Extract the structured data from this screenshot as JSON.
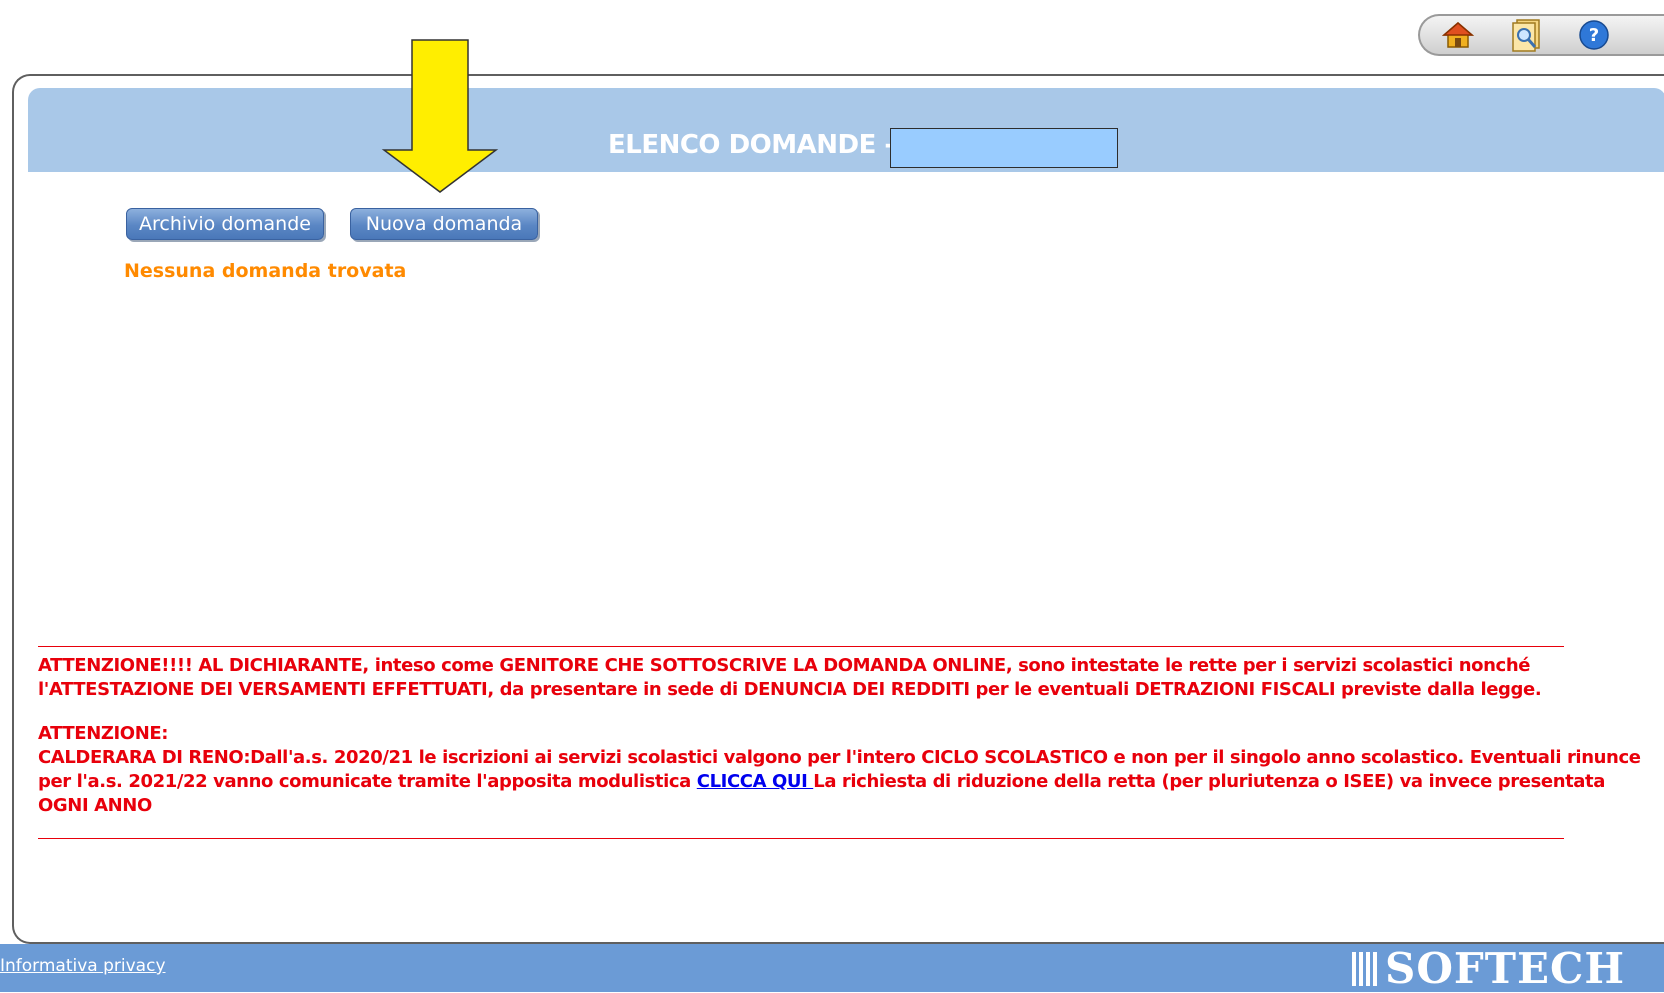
{
  "toolbar": {
    "icons": [
      "home-icon",
      "search-document-icon",
      "help-icon"
    ]
  },
  "header": {
    "title": "ELENCO DOMANDE -"
  },
  "actions": {
    "archive_label": "Archivio domande",
    "new_label": "Nuova domanda"
  },
  "status": {
    "empty_message": "Nessuna domanda trovata"
  },
  "notices": {
    "separator": "________________________________________________________________________________________________________________________________________",
    "notice1": "ATTENZIONE!!!! AL DICHIARANTE, inteso come GENITORE CHE SOTTOSCRIVE LA DOMANDA ONLINE, sono intestate le rette per i servizi scolastici nonché l'ATTESTAZIONE DEI VERSAMENTI EFFETTUATI, da presentare in sede di DENUNCIA DEI REDDITI per le eventuali DETRAZIONI FISCALI previste dalla legge.",
    "notice2_title": "ATTENZIONE:",
    "notice2_before_link": "CALDERARA DI RENO:Dall'a.s. 2020/21 le iscrizioni ai servizi scolastici valgono per l'intero CICLO SCOLASTICO e non per il singolo anno scolastico. Eventuali rinunce per l'a.s. 2021/22 vanno comunicate tramite l'apposita modulistica ",
    "notice2_link": "CLICCA QUI ",
    "notice2_after_link": "La richiesta di riduzione della retta (per pluriutenza o ISEE) va invece presentata OGNI ANNO"
  },
  "footer": {
    "privacy_label": "Informativa privacy",
    "brand": "SOFTECH"
  },
  "colors": {
    "header_bg": "#a9c8e8",
    "masked_field": "#99ccff",
    "button_bg": "#5a86c4",
    "empty_message": "#ff8a00",
    "notice_text": "#e8000b",
    "link": "#0000ee",
    "footer_bg": "#6b9bd6",
    "arrow": "#ffee00"
  }
}
